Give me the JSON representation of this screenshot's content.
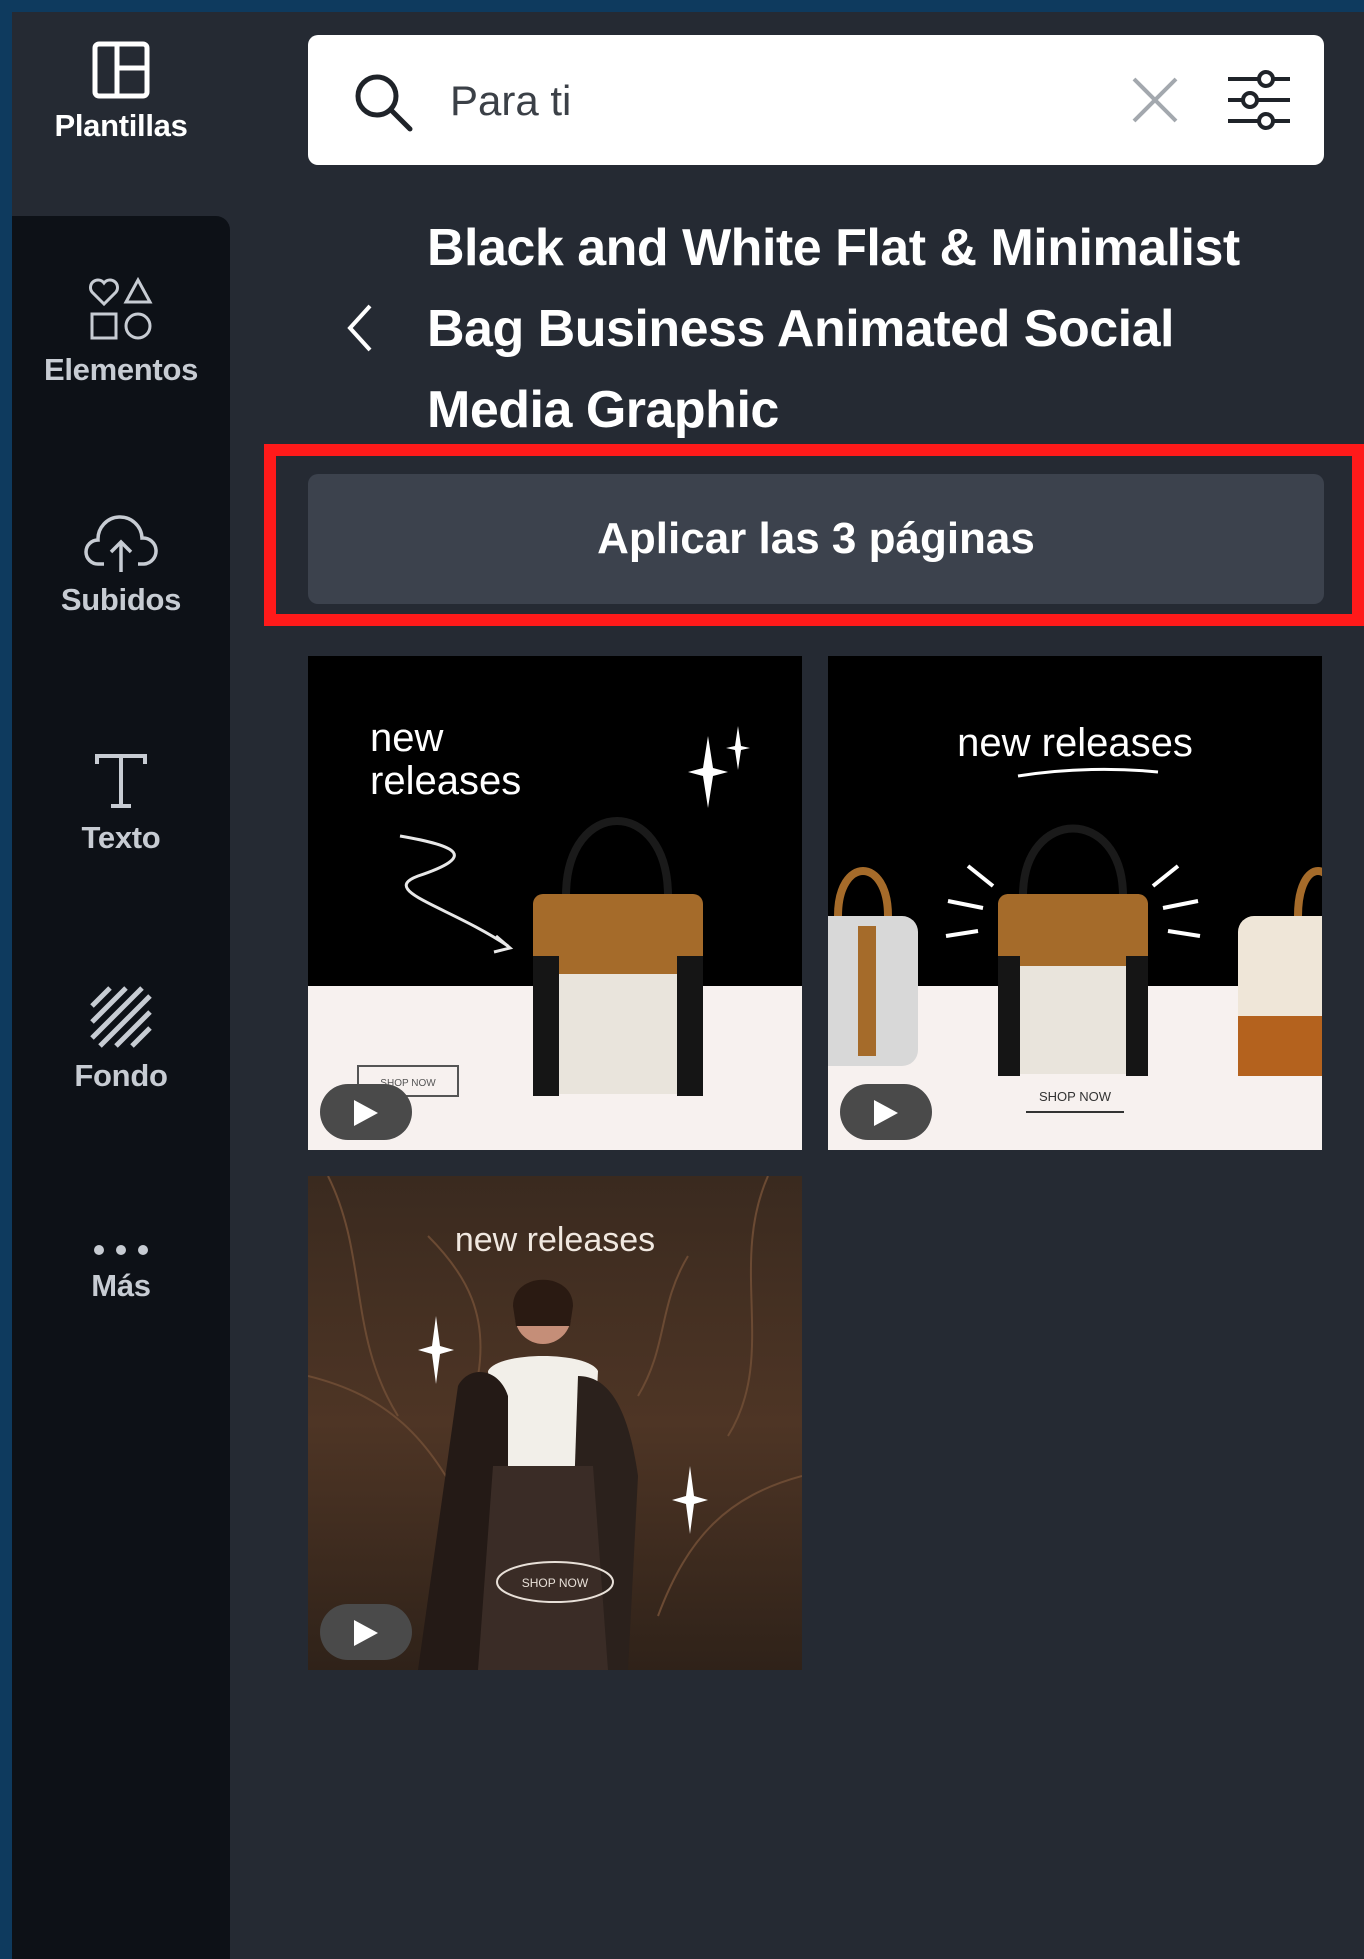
{
  "sidebar": {
    "items": [
      {
        "label": "Plantillas",
        "icon": "templates-icon",
        "active": true
      },
      {
        "label": "Elementos",
        "icon": "elements-icon"
      },
      {
        "label": "Subidos",
        "icon": "upload-cloud-icon"
      },
      {
        "label": "Texto",
        "icon": "text-icon"
      },
      {
        "label": "Fondo",
        "icon": "background-icon"
      },
      {
        "label": "Más",
        "icon": "more-icon"
      }
    ]
  },
  "search": {
    "value": "Para ti",
    "icons": [
      "search-icon",
      "clear-icon",
      "filter-icon"
    ]
  },
  "template": {
    "title_lines": [
      "Black and White Flat & Minimalist",
      "Bag Business Animated Social",
      "Media Graphic"
    ],
    "apply_label": "Aplicar las 3 páginas"
  },
  "thumbnails": [
    {
      "heading_line1": "new",
      "heading_line2": "releases",
      "cta": "SHOP NOW"
    },
    {
      "heading": "new releases",
      "cta": "SHOP NOW"
    },
    {
      "heading": "new releases",
      "cta": "SHOP NOW"
    }
  ],
  "colors": {
    "accent_highlight": "#ff1a1a",
    "panel_bg": "#252a33",
    "rail_bg": "#0d1117",
    "button_bg": "#3c424d"
  }
}
